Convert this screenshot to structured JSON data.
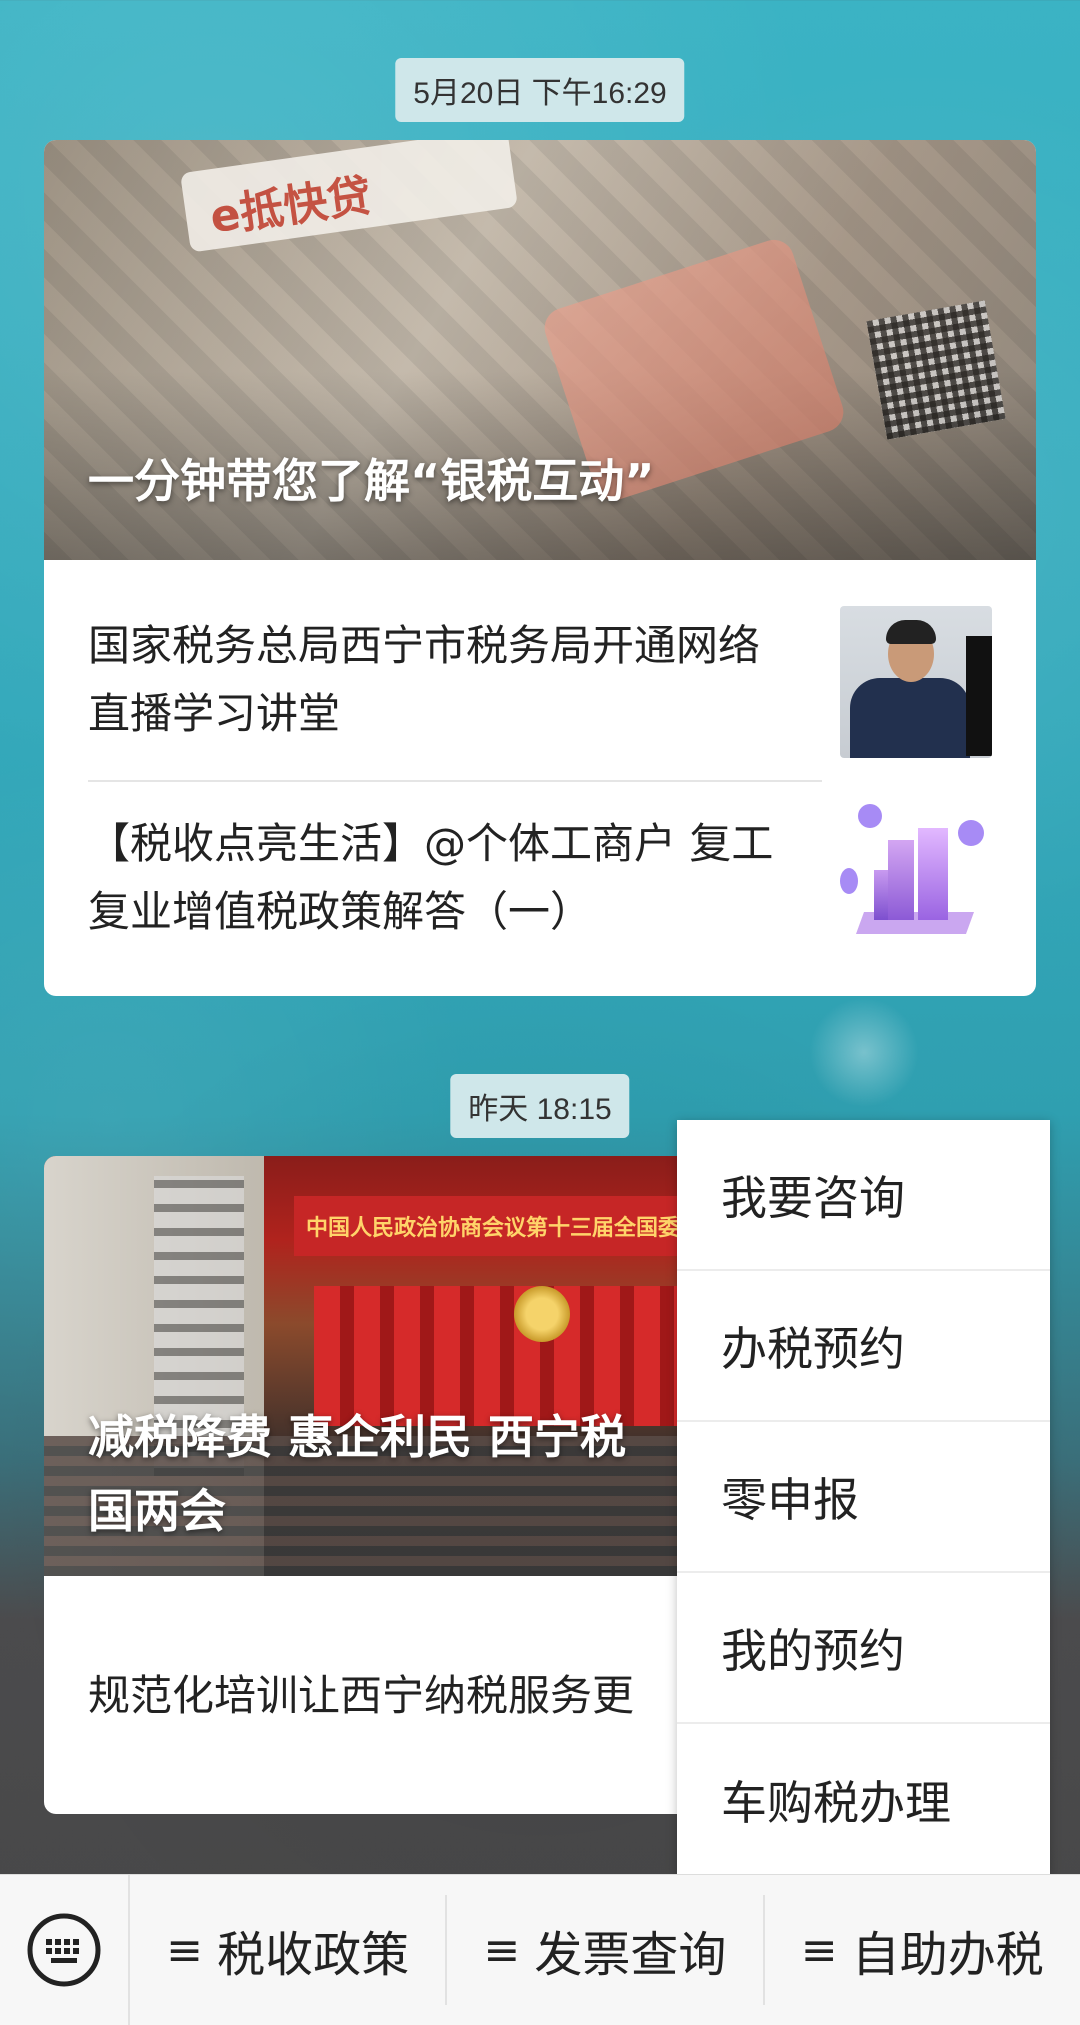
{
  "chat": {
    "timestamp1": "5月20日 下午16:29",
    "timestamp2": "昨天 18:15"
  },
  "article1": {
    "hero_title": "一分钟带您了解“银税互动”",
    "hero_decor_text": "e抵快贷",
    "items": [
      {
        "title_line1": "国家税务总局西宁市税务局开通网络",
        "title_line2": "直播学习讲堂",
        "thumb": "officer-at-computer"
      },
      {
        "title_line1": "【税收点亮生活】@个体工商户 复工",
        "title_line2": "复业增值税政策解答（一）",
        "thumb": "purple-city-illustration"
      }
    ]
  },
  "article2": {
    "hero_title_line1": "减税降费  惠企利民  西宁税",
    "hero_title_line2": "国两会",
    "hero_banner_text": "中国人民政治协商会议第十三届全国委员会第三",
    "item_title": "规范化培训让西宁纳税服务更"
  },
  "popup_menu": {
    "items": [
      "我要咨询",
      "办税预约",
      "零申报",
      "我的预约",
      "车购税办理"
    ]
  },
  "bottom_menu": {
    "keyboard_icon": "keyboard-icon",
    "tabs": [
      "税收政策",
      "发票查询",
      "自助办税"
    ],
    "tab_glyph": "≡"
  }
}
